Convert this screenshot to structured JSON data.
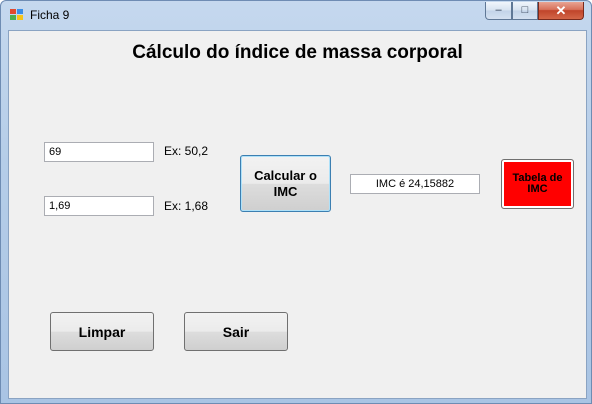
{
  "window": {
    "title": "Ficha 9",
    "controls": {
      "minimize": "–",
      "maximize": "□",
      "close": "✕"
    }
  },
  "form": {
    "heading": "Cálculo do índice de massa corporal",
    "weight": {
      "value": "69",
      "hint": "Ex: 50,2"
    },
    "height": {
      "value": "1,69",
      "hint": "Ex: 1,68"
    },
    "calc_button": "Calcular o IMC",
    "result": "IMC é 24,15882",
    "table_button": "Tabela de IMC",
    "clear_button": "Limpar",
    "exit_button": "Sair"
  },
  "colors": {
    "table_button_bg": "#ff0000",
    "client_bg": "#f0f0f0"
  }
}
